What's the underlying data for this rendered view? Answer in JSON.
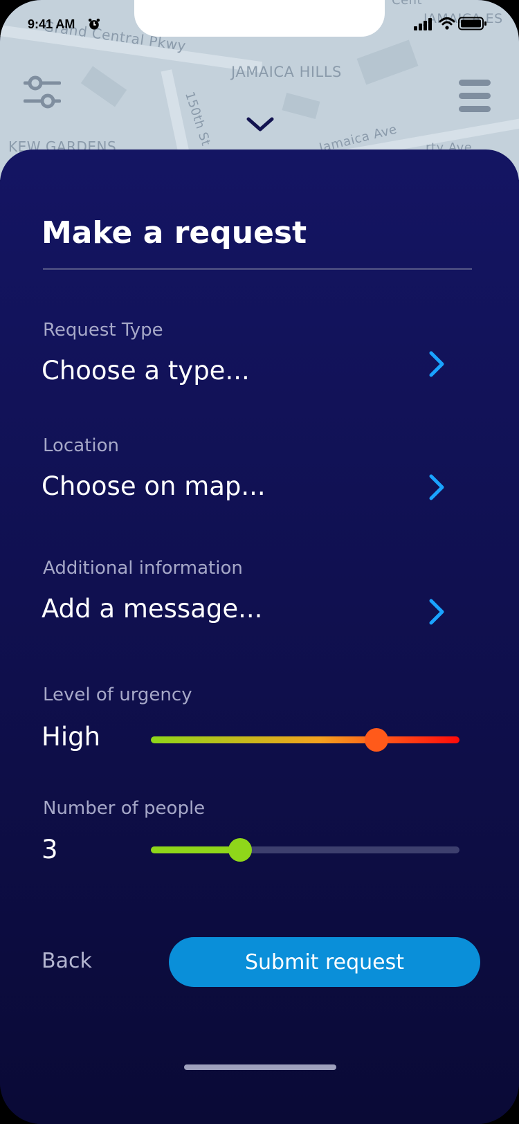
{
  "status_bar": {
    "time": "9:41 AM"
  },
  "map": {
    "labels": {
      "grand_central": "Grand Central Pkwy",
      "jamaica_hills": "JAMAICA HILLS",
      "street_150th": "150th St",
      "kew_gardens": "KEW GARDENS",
      "jamaica_ave": "Jamaica Ave",
      "jamaica_es": "JAMAICA ES",
      "cent": "Cent",
      "rty_ave": "rty Ave"
    }
  },
  "sheet": {
    "title": "Make a request",
    "request_type": {
      "label": "Request Type",
      "value": "Choose a type..."
    },
    "location": {
      "label": "Location",
      "value": "Choose on map..."
    },
    "additional_info": {
      "label": "Additional information",
      "value": "Add a message..."
    },
    "urgency": {
      "label": "Level of urgency",
      "value": "High",
      "level": 0.73
    },
    "people": {
      "label": "Number of people",
      "value": "3",
      "level": 0.29
    },
    "back_label": "Back",
    "submit_label": "Submit request"
  },
  "colors": {
    "accent": "#0a8fd9",
    "chevron": "#1aa3ff",
    "slider_green": "#8fd61a",
    "slider_orange": "#ff5a1a",
    "slider_red": "#ff0a0a",
    "sheet_bg": "#141563"
  },
  "icons": [
    "alarm-icon",
    "signal-icon",
    "wifi-icon",
    "battery-icon",
    "filter-icon",
    "menu-icon",
    "chevron-down-icon",
    "chevron-right-icon"
  ]
}
